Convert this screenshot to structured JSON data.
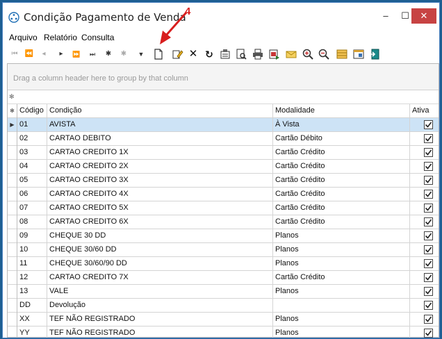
{
  "window": {
    "title": "Condição Pagamento de Venda",
    "marker": "4",
    "min_glyph": "–",
    "max_glyph": "☐",
    "close_glyph": "✕"
  },
  "menu": {
    "items": [
      {
        "label": "Arquivo"
      },
      {
        "label": "Relatório"
      },
      {
        "label": "Consulta"
      }
    ]
  },
  "toolbar": {
    "nav": [
      "first-icon",
      "prev-page-icon",
      "prev-icon",
      "next-icon",
      "next-page-icon",
      "last-icon",
      "insert-icon",
      "delete-icon",
      "filter-icon"
    ],
    "actions": [
      "new-icon",
      "edit-icon",
      "delete-icon",
      "refresh-icon",
      "properties-icon",
      "preview-icon",
      "print-icon",
      "export-icon",
      "email-icon",
      "zoom-in-icon",
      "zoom-out-icon",
      "layout-icon",
      "window-icon",
      "exit-icon"
    ]
  },
  "grid": {
    "group_placeholder": "Drag a column header here to group by that column",
    "filter_marker": "✻",
    "header_marker": "✻",
    "columns": {
      "codigo": "Código",
      "condicao": "Condição",
      "modalidade": "Modalidade",
      "ativa": "Ativa"
    },
    "rows": [
      {
        "codigo": "01",
        "condicao": "AVISTA",
        "modalidade": "À Vista",
        "ativa": true
      },
      {
        "codigo": "02",
        "condicao": "CARTAO DEBITO",
        "modalidade": "Cartão Débito",
        "ativa": true
      },
      {
        "codigo": "03",
        "condicao": "CARTAO CREDITO 1X",
        "modalidade": "Cartão Crédito",
        "ativa": true
      },
      {
        "codigo": "04",
        "condicao": "CARTAO CREDITO 2X",
        "modalidade": "Cartão Crédito",
        "ativa": true
      },
      {
        "codigo": "05",
        "condicao": "CARTAO CREDITO 3X",
        "modalidade": "Cartão Crédito",
        "ativa": true
      },
      {
        "codigo": "06",
        "condicao": "CARTAO CREDITO 4X",
        "modalidade": "Cartão Crédito",
        "ativa": true
      },
      {
        "codigo": "07",
        "condicao": "CARTAO CREDITO 5X",
        "modalidade": "Cartão Crédito",
        "ativa": true
      },
      {
        "codigo": "08",
        "condicao": "CARTAO CREDITO 6X",
        "modalidade": "Cartão Crédito",
        "ativa": true
      },
      {
        "codigo": "09",
        "condicao": "CHEQUE 30 DD",
        "modalidade": "Planos",
        "ativa": true
      },
      {
        "codigo": "10",
        "condicao": "CHEQUE 30/60 DD",
        "modalidade": "Planos",
        "ativa": true
      },
      {
        "codigo": "11",
        "condicao": "CHEQUE 30/60/90 DD",
        "modalidade": "Planos",
        "ativa": true
      },
      {
        "codigo": "12",
        "condicao": "CARTAO CREDITO 7X",
        "modalidade": "Cartão Crédito",
        "ativa": true
      },
      {
        "codigo": "13",
        "condicao": "VALE",
        "modalidade": "Planos",
        "ativa": true
      },
      {
        "codigo": "DD",
        "condicao": "Devolução",
        "modalidade": "",
        "ativa": true
      },
      {
        "codigo": "XX",
        "condicao": "TEF NÃO REGISTRADO",
        "modalidade": "Planos",
        "ativa": true
      },
      {
        "codigo": "YY",
        "condicao": "TEF NÃO REGISTRADO",
        "modalidade": "Planos",
        "ativa": true
      }
    ]
  },
  "colors": {
    "accent": "#d81e1e",
    "selection": "#cde3f6",
    "close": "#c74343"
  }
}
